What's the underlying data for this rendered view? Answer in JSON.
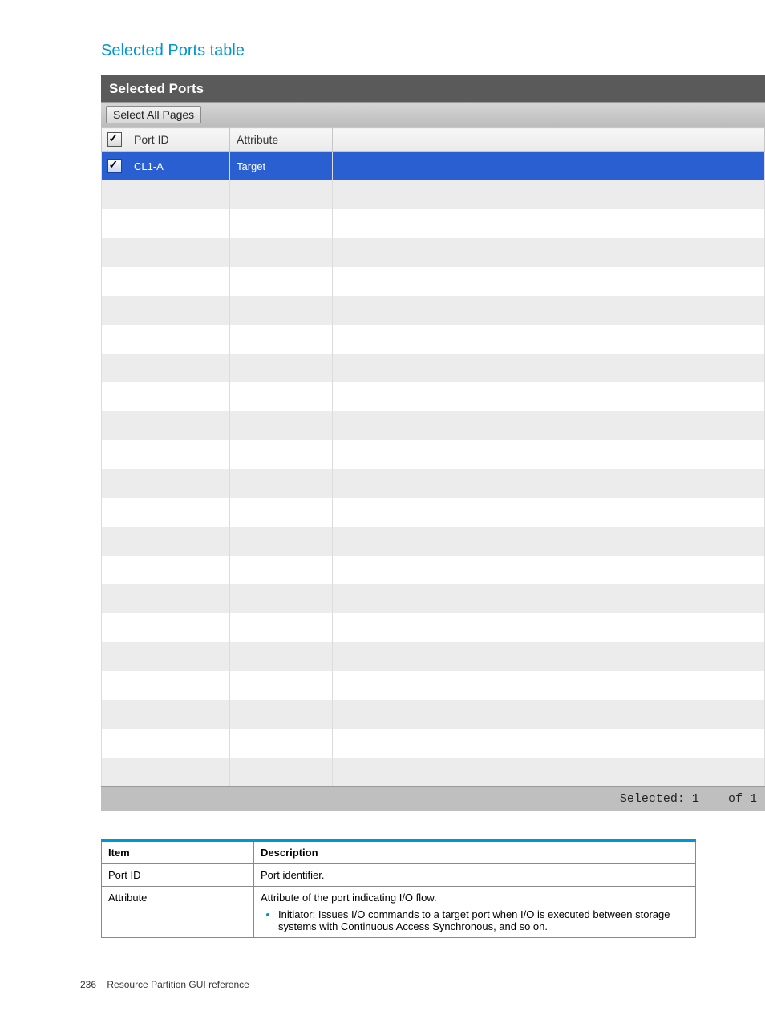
{
  "section_title": "Selected Ports table",
  "panel": {
    "title": "Selected Ports",
    "select_all_btn": "Select All Pages",
    "columns": {
      "port_id": "Port ID",
      "attribute": "Attribute"
    },
    "row": {
      "port_id": "CL1-A",
      "attribute": "Target"
    },
    "empty_row_count": 21,
    "footer": {
      "label": "Selected:",
      "selected": "1",
      "of": "of",
      "total": "1"
    }
  },
  "desc": {
    "head_item": "Item",
    "head_desc": "Description",
    "rows": [
      {
        "item": "Port ID",
        "desc": "Port identifier."
      },
      {
        "item": "Attribute",
        "desc": "Attribute of the port indicating I/O flow.",
        "bullet": "Initiator: Issues I/O commands to a target port when I/O is executed between storage systems with Continuous Access Synchronous, and so on."
      }
    ]
  },
  "footer": {
    "page": "236",
    "chapter": "Resource Partition GUI reference"
  }
}
